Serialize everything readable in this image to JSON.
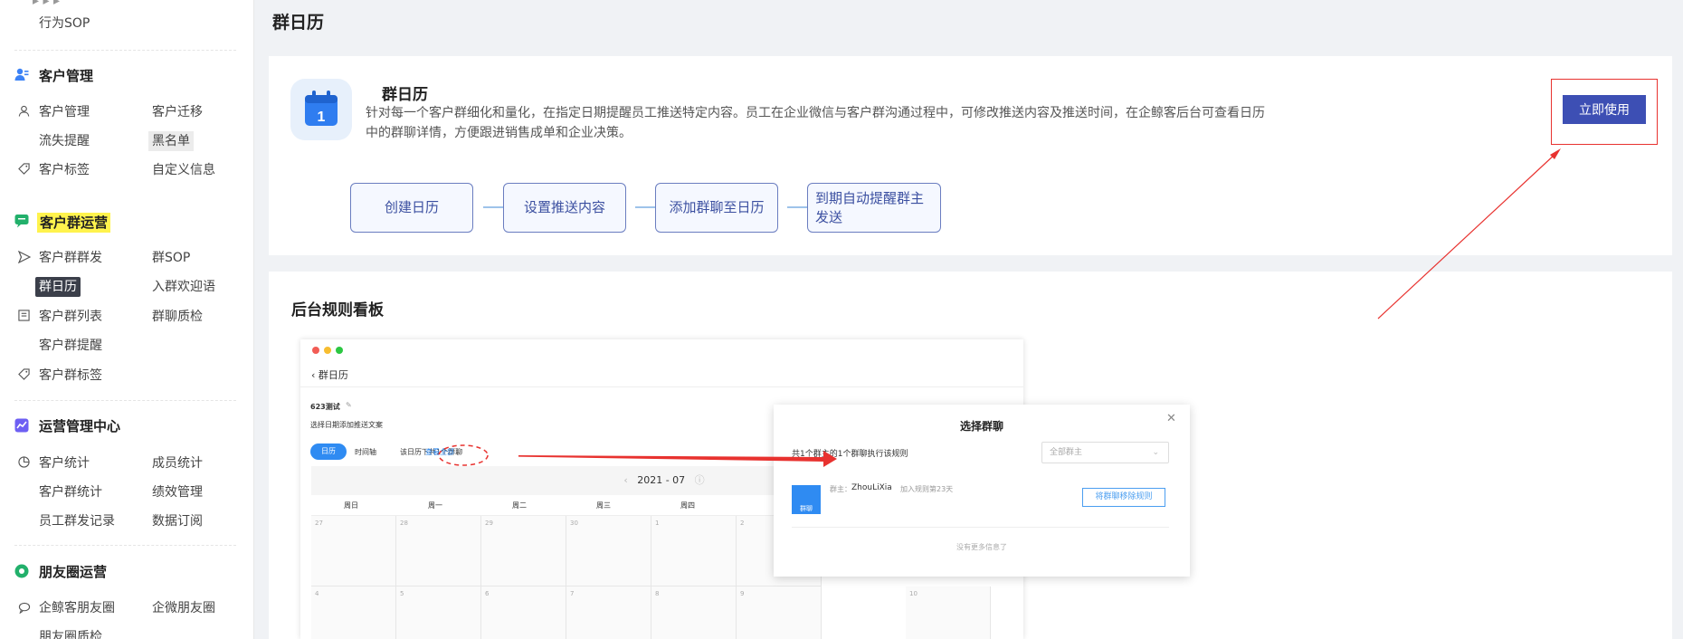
{
  "sidebar": {
    "top_partial_left": "行为SOP",
    "categories": [
      {
        "title": "客户管理",
        "items": [
          "客户管理",
          "客户迁移",
          "流失提醒",
          "黑名单",
          "客户标签",
          "自定义信息"
        ]
      },
      {
        "title": "客户群运营",
        "items": [
          "客户群群发",
          "群SOP",
          "群日历",
          "入群欢迎语",
          "客户群列表",
          "群聊质检",
          "客户群提醒",
          "客户群标签"
        ]
      },
      {
        "title": "运营管理中心",
        "items": [
          "客户统计",
          "成员统计",
          "客户群统计",
          "绩效管理",
          "员工群发记录",
          "数据订阅"
        ]
      },
      {
        "title": "朋友圈运营",
        "items": [
          "企鲸客朋友圈",
          "企微朋友圈",
          "朋友圈质检"
        ]
      }
    ]
  },
  "page": {
    "title": "群日历"
  },
  "intro": {
    "title": "群日历",
    "description": "针对每一个客户群细化和量化，在指定日期提醒员工推送特定内容。员工在企业微信与客户群沟通过程中，可修改推送内容及推送时间，在企鲸客后台可查看日历中的群聊详情，方便跟进销售成单和企业决策。",
    "use_button": "立即使用",
    "calendar_icon_number": "1",
    "steps": [
      "创建日历",
      "设置推送内容",
      "添加群聊至日历",
      "到期自动提醒群主发送"
    ]
  },
  "board": {
    "title": "后台规则看板",
    "screenshot": {
      "back_title": "群日历",
      "calendar_name": "623测试",
      "hint": "选择日期添加推送文案",
      "tab_calendar": "日历",
      "tab_timeline": "时间轴",
      "group_count": "该日历下共1个群聊",
      "view_all": "查看全部",
      "month": "2021 - 07",
      "weekdays": [
        "周日",
        "周一",
        "周二",
        "周三",
        "周四"
      ],
      "row1_dates": [
        "27",
        "28",
        "29",
        "30",
        "1",
        "2"
      ],
      "row2_dates": [
        "4",
        "5",
        "6",
        "7",
        "8",
        "9",
        "10"
      ]
    },
    "dialog": {
      "title": "选择群聊",
      "summary": "共1个群主的1个群聊执行该规则",
      "owner_select": "全部群主",
      "avatar_label": "群聊",
      "owner_prefix": "群主：",
      "owner_name": "ZhouLiXia",
      "joined": "加入规则第23天",
      "remove_button": "将群聊移除规则",
      "no_more": "没有更多信息了"
    }
  },
  "colors": {
    "brand": "#3d4fb4",
    "highlight_red": "#e8322f",
    "step_border": "#6a7dc0",
    "wechat_blue": "#2f8bf2"
  }
}
